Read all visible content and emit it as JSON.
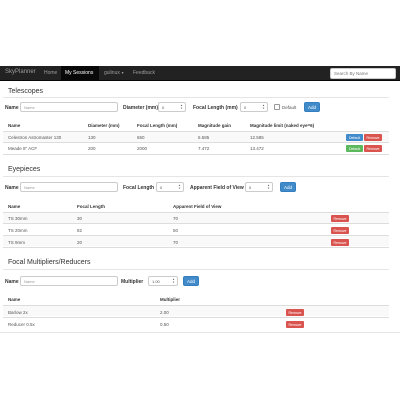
{
  "navbar": {
    "brand": "SkyPlanner",
    "items": [
      {
        "label": "Home",
        "active": false
      },
      {
        "label": "My Sessions",
        "active": true
      },
      {
        "label": "gulinux",
        "active": false,
        "dropdown": true
      },
      {
        "label": "Feedback",
        "active": false
      }
    ],
    "search_placeholder": "Search By Name"
  },
  "telescopes": {
    "title": "Telescopes",
    "form": {
      "name_label": "Name",
      "name_placeholder": "Name",
      "diameter_label": "Diameter (mm)",
      "diameter_value": "0",
      "focal_label": "Focal Length (mm)",
      "focal_value": "0",
      "default_label": "Default",
      "add_label": "Add"
    },
    "columns": [
      "Name",
      "Diameter (mm)",
      "Focal Length (mm)",
      "Magnitude gain",
      "Magnitude limit (naked eye=6)"
    ],
    "rows": [
      {
        "name": "Celestron Astromaster 130",
        "diameter": "130",
        "focal": "650",
        "gain": "6.585",
        "limit": "12.585",
        "default_label": "Default",
        "remove_label": "Remove",
        "is_default": false
      },
      {
        "name": "Meade 8\" ACF",
        "diameter": "200",
        "focal": "2000",
        "gain": "7.472",
        "limit": "13.472",
        "default_label": "Default",
        "remove_label": "Remove",
        "is_default": true
      }
    ]
  },
  "eyepieces": {
    "title": "Eyepieces",
    "form": {
      "name_label": "Name",
      "name_placeholder": "Name",
      "focal_label": "Focal Length",
      "focal_value": "0",
      "afov_label": "Apparent Field of View",
      "afov_value": "0",
      "add_label": "Add"
    },
    "columns": [
      "Name",
      "Focal Length",
      "Apparent Field of View"
    ],
    "rows": [
      {
        "name": "TS 30mm",
        "focal": "30",
        "afov": "70",
        "remove_label": "Remove"
      },
      {
        "name": "TS 20mm",
        "focal": "82",
        "afov": "50",
        "remove_label": "Remove"
      },
      {
        "name": "TS 9mm",
        "focal": "20",
        "afov": "70",
        "remove_label": "Remove"
      }
    ]
  },
  "multipliers": {
    "title": "Focal Multipliers/Reducers",
    "form": {
      "name_label": "Name",
      "name_placeholder": "Name",
      "multiplier_label": "Multiplier",
      "multiplier_value": "1.00",
      "add_label": "Add"
    },
    "columns": [
      "Name",
      "Multiplier"
    ],
    "rows": [
      {
        "name": "Barlow 2x",
        "multiplier": "2.00",
        "remove_label": "Remove"
      },
      {
        "name": "Reducer 0.5x",
        "multiplier": "0.50",
        "remove_label": "Remove"
      }
    ]
  },
  "colors": {
    "navbar_bg": "#222222",
    "primary": "#428bca",
    "success": "#5cb85c",
    "danger": "#d9534f"
  }
}
